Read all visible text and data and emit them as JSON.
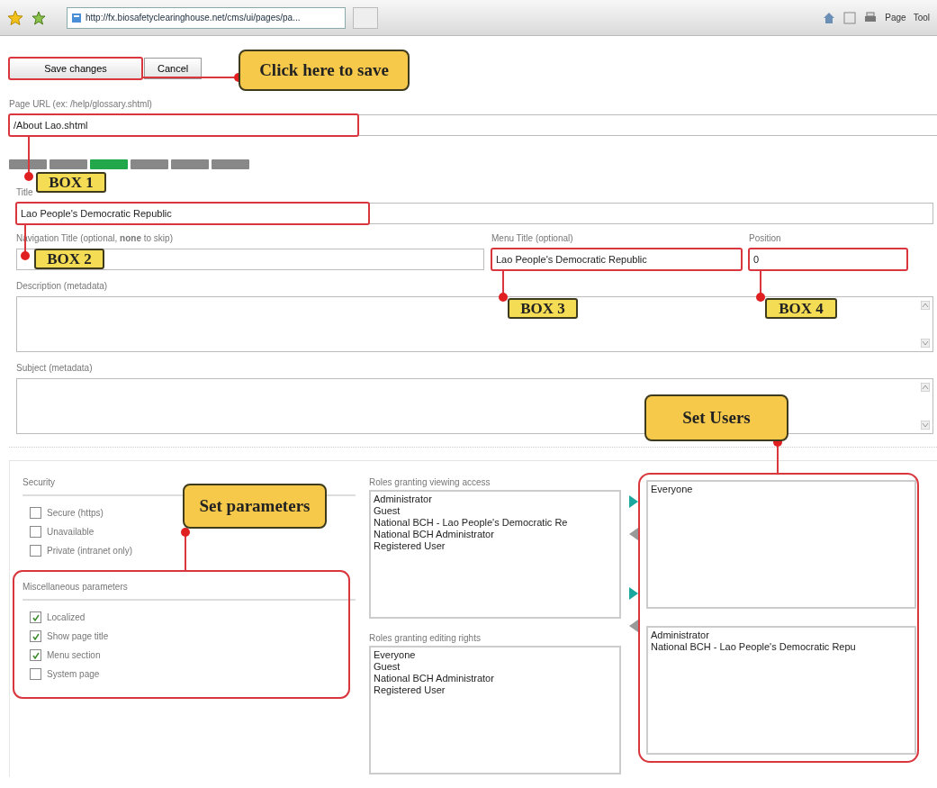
{
  "browser": {
    "address": "http://fx.biosafetyclearinghouse.net/cms/ui/pages/pa...",
    "menus": [
      "Page",
      "Tool"
    ]
  },
  "buttons": [
    {
      "label": "Save changes"
    },
    {
      "label": "Cancel"
    }
  ],
  "page_url": {
    "label": "Page URL (ex: /help/glossary.shtml)",
    "value": "/About Lao.shtml"
  },
  "language_tabs": [
    {
      "selected": false
    },
    {
      "selected": false
    },
    {
      "selected": true
    },
    {
      "selected": false
    },
    {
      "selected": false
    },
    {
      "selected": false
    }
  ],
  "title": {
    "label": "Title",
    "value": "Lao People's Democratic Republic"
  },
  "navigation_title": {
    "label": "Navigation Title (optional, **none** to skip)"
  },
  "menu_title": {
    "label": "Menu Title (optional)",
    "value": "Lao People's Democratic Republic"
  },
  "position": {
    "label": "Position",
    "value": "0"
  },
  "description": {
    "label": "Description (metadata)"
  },
  "subject": {
    "label": "Subject (metadata)"
  },
  "security": {
    "title": "Security",
    "options": [
      {
        "label": "Secure (https)",
        "checked": false
      },
      {
        "label": "Unavailable",
        "checked": false
      },
      {
        "label": "Private (intranet only)",
        "checked": false
      }
    ]
  },
  "misc": {
    "title": "Miscellaneous parameters",
    "options": [
      {
        "label": "Localized",
        "checked": true
      },
      {
        "label": "Show page title",
        "checked": true
      },
      {
        "label": "Menu section",
        "checked": true
      },
      {
        "label": "System page",
        "checked": false
      }
    ]
  },
  "roles": [
    {
      "title": "Roles granting viewing access",
      "available": [
        "Administrator",
        "Guest",
        "National BCH - Lao People's Democratic Re",
        "National BCH Administrator",
        "Registered User"
      ],
      "granted": [
        "Everyone"
      ]
    },
    {
      "title": "Roles granting editing rights",
      "available": [
        "Everyone",
        "Guest",
        "National BCH Administrator",
        "Registered User"
      ],
      "granted": [
        "Administrator",
        "National BCH - Lao People's Democratic Repu"
      ]
    }
  ],
  "annotations": [
    {
      "label": "Click here to save",
      "kind": "note"
    },
    {
      "label": "BOX 1",
      "kind": "tag"
    },
    {
      "label": "BOX 2",
      "kind": "tag"
    },
    {
      "label": "BOX 3",
      "kind": "tag"
    },
    {
      "label": "BOX 4",
      "kind": "tag"
    },
    {
      "label": "Set parameters",
      "kind": "note"
    },
    {
      "label": "Set Users",
      "kind": "note"
    }
  ]
}
